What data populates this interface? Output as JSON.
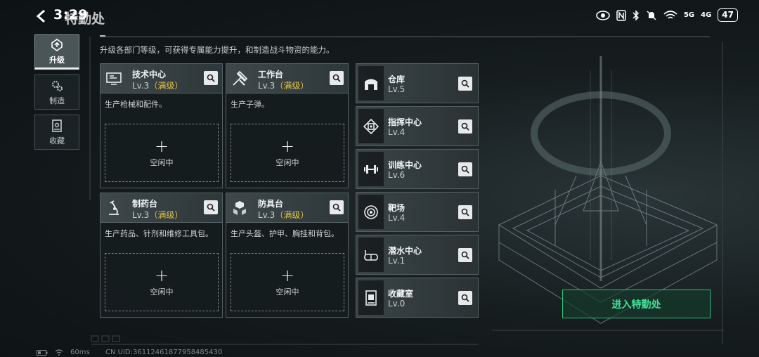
{
  "status_bar": {
    "time": "3:29",
    "battery": "47",
    "signal_1": "5G",
    "signal_2": "4G"
  },
  "header": {
    "title": "特勤处",
    "description": "升级各部门等级，可获得专属能力提升，和制造战斗物资的能力。"
  },
  "sidenav": [
    {
      "label": "升级",
      "icon": "upgrade-icon",
      "active": true
    },
    {
      "label": "制造",
      "icon": "gears-icon",
      "active": false
    },
    {
      "label": "收藏",
      "icon": "collection-icon",
      "active": false
    }
  ],
  "departments": [
    {
      "name": "技术中心",
      "level": "Lv.3",
      "max": "（满级）",
      "desc": "生产枪械和配件。",
      "slot_plus": "+",
      "slot_status": "空闲中",
      "icon": "monitor-icon"
    },
    {
      "name": "工作台",
      "level": "Lv.3",
      "max": "（满级）",
      "desc": "生产子弹。",
      "slot_plus": "+",
      "slot_status": "空闲中",
      "icon": "tools-icon"
    },
    {
      "name": "制药台",
      "level": "Lv.3",
      "max": "（满级）",
      "desc": "生产药品、针剂和维修工具包。",
      "slot_plus": "+",
      "slot_status": "空闲中",
      "icon": "microscope-icon"
    },
    {
      "name": "防具台",
      "level": "Lv.3",
      "max": "（满级）",
      "desc": "生产头盔、护甲、胸挂和背包。",
      "slot_plus": "+",
      "slot_status": "空闲中",
      "icon": "armor-boxes-icon"
    }
  ],
  "facilities": [
    {
      "name": "仓库",
      "level": "Lv.5",
      "icon": "warehouse-icon"
    },
    {
      "name": "指挥中心",
      "level": "Lv.4",
      "icon": "command-chip-icon"
    },
    {
      "name": "训练中心",
      "level": "Lv.6",
      "icon": "dumbbell-icon"
    },
    {
      "name": "靶场",
      "level": "Lv.4",
      "icon": "target-icon"
    },
    {
      "name": "潜水中心",
      "level": "Lv.1",
      "icon": "diving-mask-icon"
    },
    {
      "name": "收藏室",
      "level": "Lv.0",
      "icon": "display-case-icon"
    }
  ],
  "enter_button": "进入特勤处",
  "footer": {
    "ping": "60ms",
    "uid": "CN UID:36112461877958485430"
  },
  "colors": {
    "accent_green": "#3fe39a",
    "max_level_gold": "#e2c24a"
  }
}
